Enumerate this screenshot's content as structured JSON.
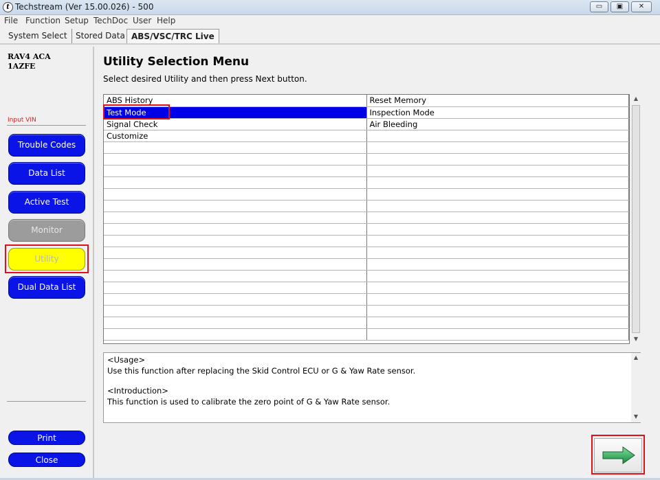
{
  "window": {
    "title": "Techstream (Ver 15.00.026) - 500",
    "minimize_label": "▭",
    "maximize_label": "▣",
    "close_label": "✕"
  },
  "menu": [
    "File",
    "Function",
    "Setup",
    "TechDoc",
    "User",
    "Help"
  ],
  "tabs": [
    "System Select",
    "Stored Data",
    "ABS/VSC/TRC Live"
  ],
  "vehicle": {
    "line1": "RAV4 ACA",
    "line2": "1AZFE"
  },
  "sidebar": {
    "input_vin": "Input VIN",
    "buttons": [
      "Trouble Codes",
      "Data List",
      "Active Test",
      "Monitor",
      "Utility",
      "Dual Data List"
    ],
    "print": "Print",
    "close": "Close"
  },
  "main": {
    "title": "Utility Selection Menu",
    "instruction": "Select desired Utility and then press Next button.",
    "rows": [
      [
        "ABS History",
        "Reset Memory"
      ],
      [
        "Test Mode",
        "Inspection Mode"
      ],
      [
        "Signal Check",
        "Air Bleeding"
      ],
      [
        "Customize",
        ""
      ],
      [
        "",
        ""
      ],
      [
        "",
        ""
      ],
      [
        "",
        ""
      ],
      [
        "",
        ""
      ],
      [
        "",
        ""
      ],
      [
        "",
        ""
      ],
      [
        "",
        ""
      ],
      [
        "",
        ""
      ],
      [
        "",
        ""
      ],
      [
        "",
        ""
      ],
      [
        "",
        ""
      ],
      [
        "",
        ""
      ],
      [
        "",
        ""
      ],
      [
        "",
        ""
      ],
      [
        "",
        ""
      ],
      [
        "",
        ""
      ],
      [
        "",
        ""
      ]
    ],
    "selected_row": 1,
    "usage": {
      "usage_heading": "<Usage>",
      "usage_text": "Use this function after replacing the Skid Control ECU or G & Yaw Rate sensor.",
      "intro_heading": "<Introduction>",
      "intro_text": "This function is used to calibrate the zero point of G & Yaw Rate sensor."
    }
  },
  "colors": {
    "nav_blue": "#0a14e6",
    "selected_yellow": "#ffff00",
    "highlight_red": "#e0101a",
    "arrow_green": "#2faa55"
  },
  "icons": {
    "next": "right-arrow-icon",
    "app": "techstream-icon"
  }
}
